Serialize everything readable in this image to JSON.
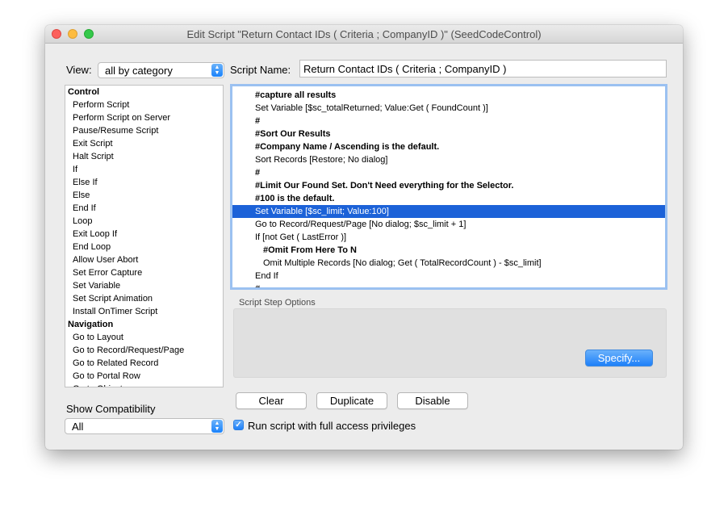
{
  "window": {
    "title": "Edit Script \"Return Contact IDs ( Criteria ; CompanyID )\" (SeedCodeControl)"
  },
  "view": {
    "label": "View:",
    "selected": "all by category"
  },
  "script_name": {
    "label": "Script Name:",
    "value": "Return Contact IDs ( Criteria ; CompanyID )"
  },
  "step_list": [
    {
      "label": "Control",
      "category": true
    },
    {
      "label": "Perform Script"
    },
    {
      "label": "Perform Script on Server"
    },
    {
      "label": "Pause/Resume Script"
    },
    {
      "label": "Exit Script"
    },
    {
      "label": "Halt Script"
    },
    {
      "label": "If"
    },
    {
      "label": "Else If"
    },
    {
      "label": "Else"
    },
    {
      "label": "End If"
    },
    {
      "label": "Loop"
    },
    {
      "label": "Exit Loop If"
    },
    {
      "label": "End Loop"
    },
    {
      "label": "Allow User Abort"
    },
    {
      "label": "Set Error Capture"
    },
    {
      "label": "Set Variable"
    },
    {
      "label": "Set Script Animation"
    },
    {
      "label": "Install OnTimer Script"
    },
    {
      "label": "Navigation",
      "category": true
    },
    {
      "label": "Go to Layout"
    },
    {
      "label": "Go to Record/Request/Page"
    },
    {
      "label": "Go to Related Record"
    },
    {
      "label": "Go to Portal Row"
    },
    {
      "label": "Go to Object"
    }
  ],
  "script_lines": [
    {
      "text": "#capture all results",
      "comment": true
    },
    {
      "text": "Set Variable [$sc_totalReturned; Value:Get ( FoundCount )]"
    },
    {
      "text": "#",
      "comment": true
    },
    {
      "text": "#Sort Our Results",
      "comment": true
    },
    {
      "text": "#Company Name / Ascending is the default.",
      "comment": true
    },
    {
      "text": "Sort Records [Restore; No dialog]"
    },
    {
      "text": "#",
      "comment": true
    },
    {
      "text": "#Limit Our Found Set.  Don't Need everything for the Selector.",
      "comment": true
    },
    {
      "text": "#100 is the default.",
      "comment": true
    },
    {
      "text": "Set Variable [$sc_limit; Value:100]",
      "selected": true
    },
    {
      "text": "Go to Record/Request/Page [No dialog; $sc_limit + 1]"
    },
    {
      "text": "If [not Get ( LastError )]"
    },
    {
      "text": "#Omit From Here To N",
      "comment": true,
      "indent": true
    },
    {
      "text": "Omit Multiple Records [No dialog; Get ( TotalRecordCount ) - $sc_limit]",
      "indent": true
    },
    {
      "text": "End If"
    },
    {
      "text": "#",
      "comment": true
    }
  ],
  "options": {
    "label": "Script Step Options",
    "specify_label": "Specify..."
  },
  "buttons": {
    "clear": "Clear",
    "duplicate": "Duplicate",
    "disable": "Disable"
  },
  "compatibility": {
    "label": "Show Compatibility",
    "selected": "All"
  },
  "full_access": {
    "label": "Run script with full access privileges",
    "checked": true
  },
  "colors": {
    "selection": "#1c62d8",
    "accent": "#1e80f9"
  }
}
